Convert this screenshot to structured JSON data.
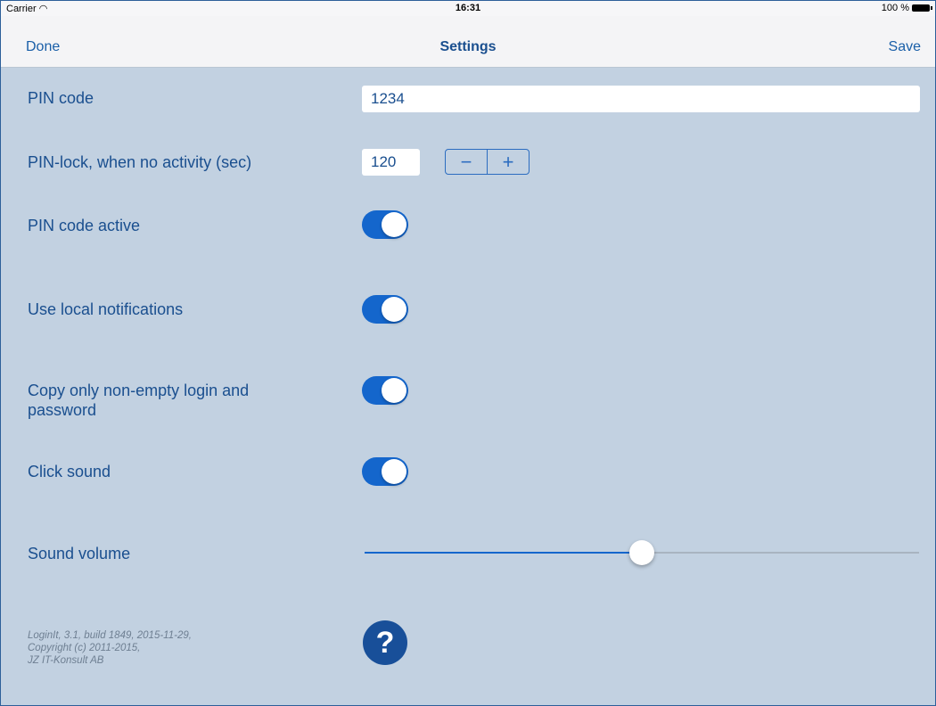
{
  "status_bar": {
    "carrier": "Carrier",
    "wifi_icon": "wifi-icon",
    "time": "16:31",
    "battery_percent": "100 %",
    "battery_icon": "battery-icon"
  },
  "nav": {
    "left_button": "Done",
    "title": "Settings",
    "right_button": "Save"
  },
  "settings": {
    "pin_code": {
      "label": "PIN code",
      "value": "1234"
    },
    "pin_lock": {
      "label": "PIN-lock, when no activity (sec)",
      "value": "120",
      "minus": "−",
      "plus": "+"
    },
    "pin_active": {
      "label": "PIN code active",
      "on": true
    },
    "local_notifications": {
      "label": "Use local notifications",
      "on": true
    },
    "copy_nonempty": {
      "label_line1": "Copy only non-empty login and",
      "label_line2": "password",
      "on": true
    },
    "click_sound": {
      "label": "Click sound",
      "on": true
    },
    "sound_volume": {
      "label": "Sound volume",
      "value_fraction": 0.5
    }
  },
  "footer": {
    "line1": "LoginIt, 3.1, build 1849, 2015-11-29,",
    "line2": "Copyright (c) 2011-2015,",
    "line3": "JZ IT-Konsult AB",
    "help_icon": "help-icon",
    "help_glyph": "?"
  },
  "colors": {
    "background": "#c2d1e1",
    "accent": "#1466cc",
    "text": "#1a4f8f"
  }
}
